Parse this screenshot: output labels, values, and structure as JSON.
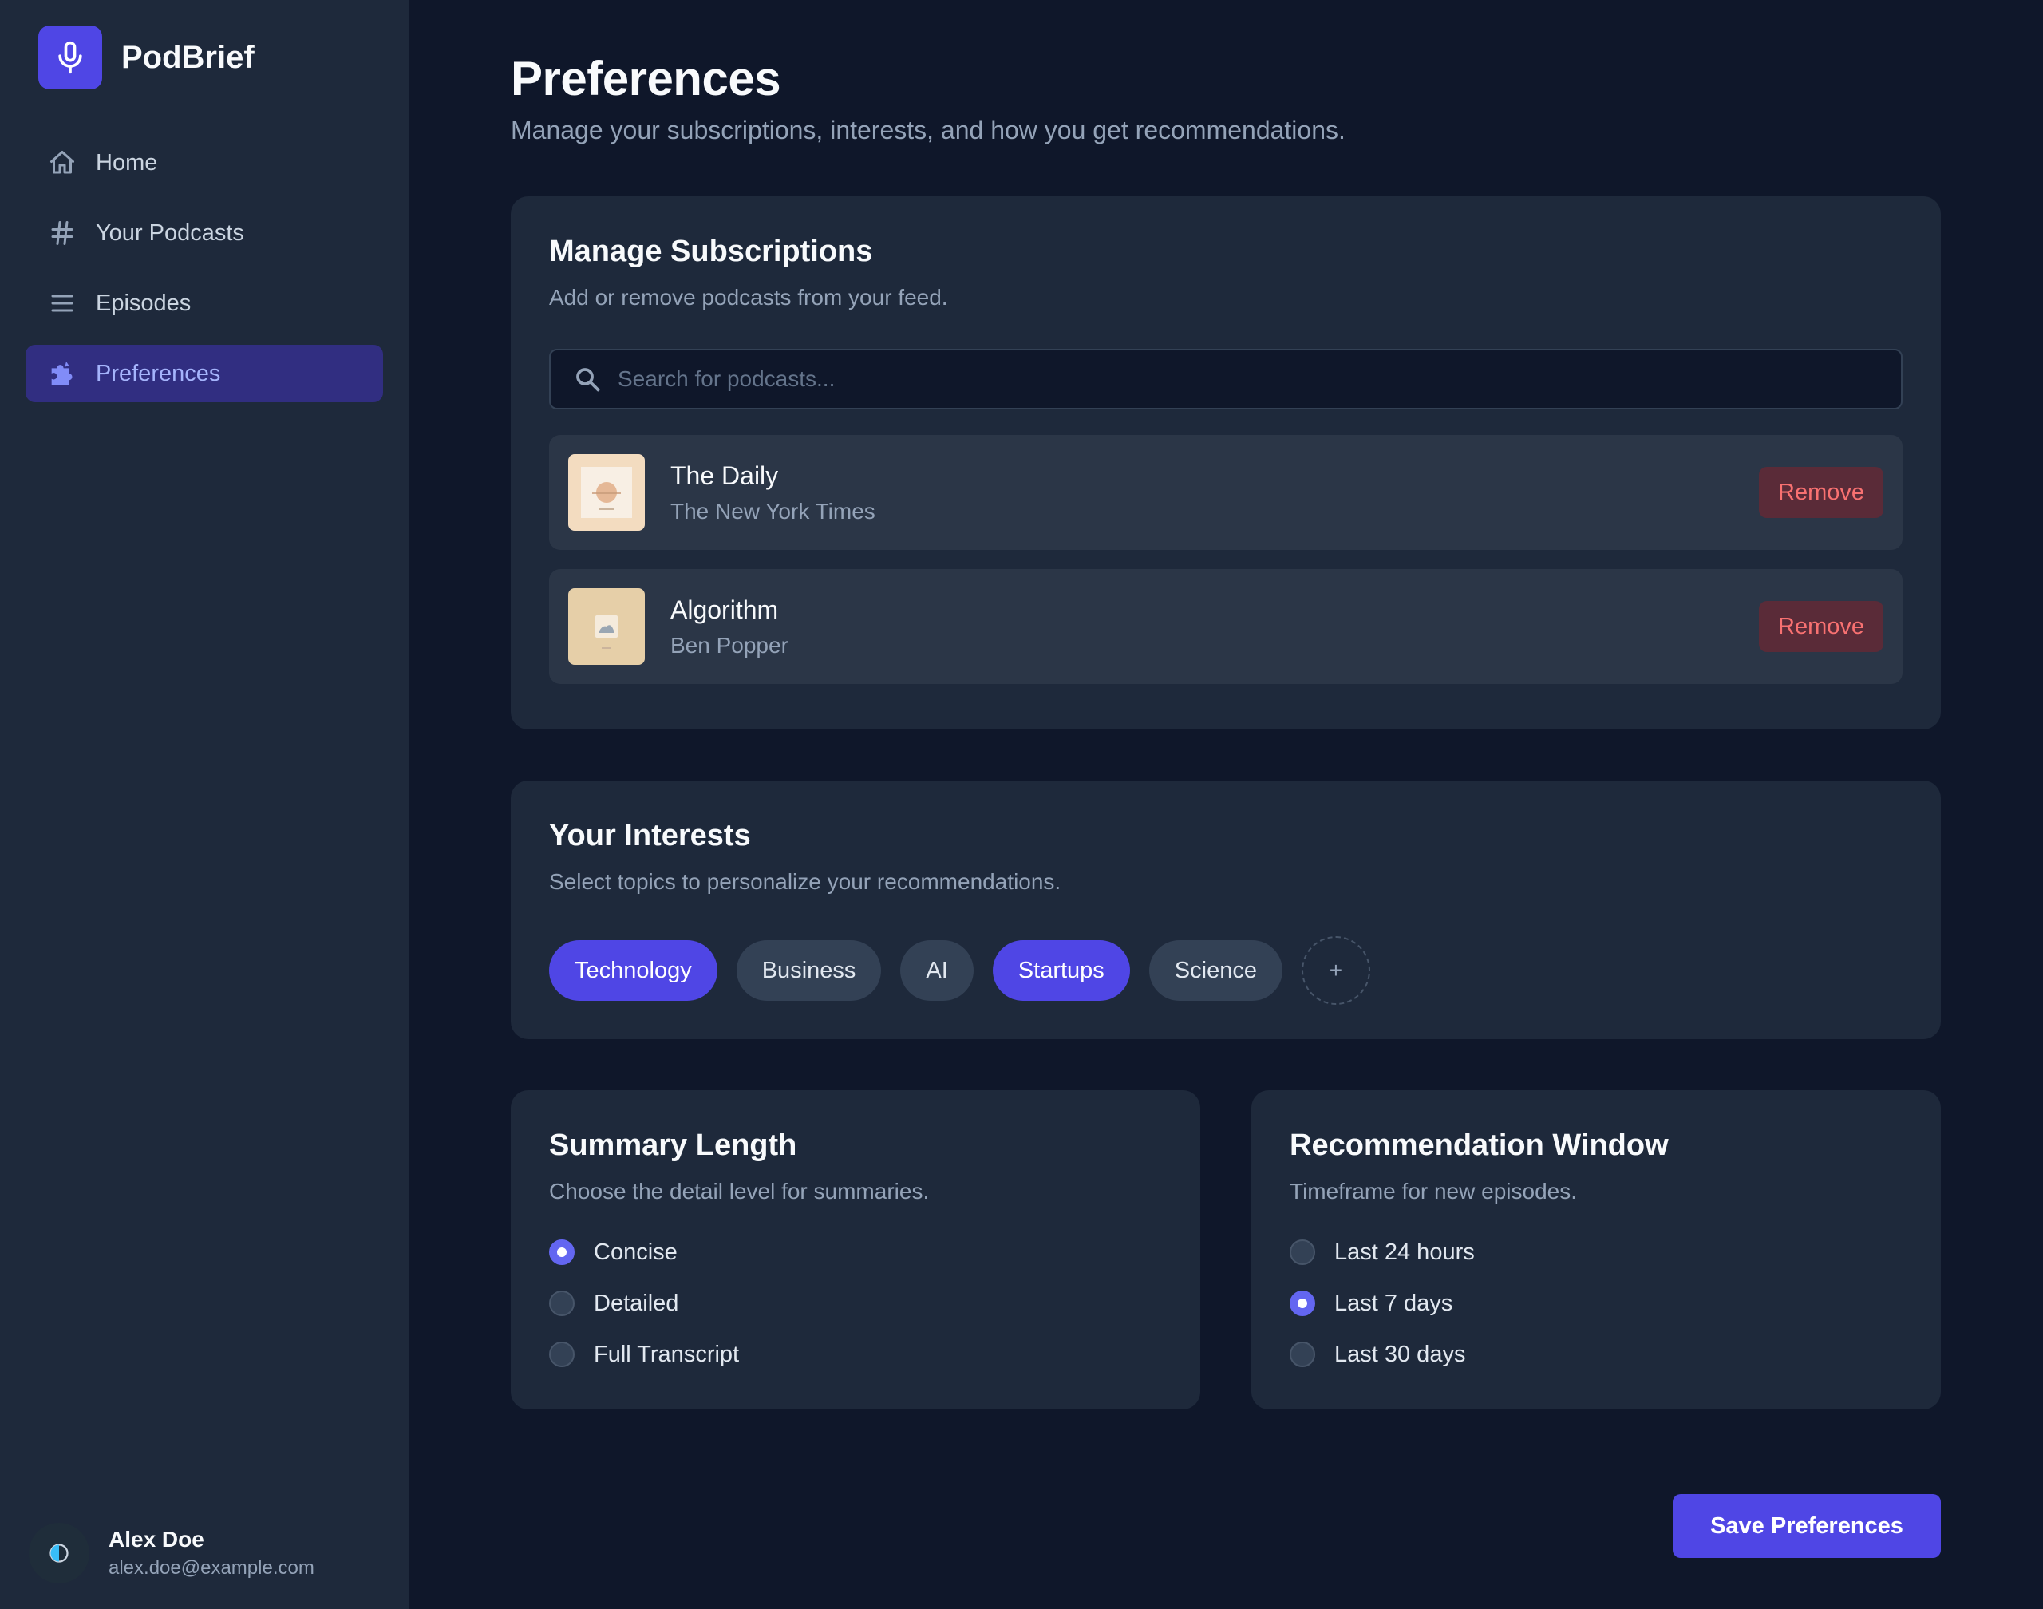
{
  "app": {
    "name": "PodBrief"
  },
  "sidebar": {
    "items": [
      {
        "label": "Home",
        "icon": "home-icon",
        "active": false
      },
      {
        "label": "Your Podcasts",
        "icon": "hash-icon",
        "active": false
      },
      {
        "label": "Episodes",
        "icon": "list-icon",
        "active": false
      },
      {
        "label": "Preferences",
        "icon": "puzzle-icon",
        "active": true
      }
    ]
  },
  "user": {
    "name": "Alex Doe",
    "email": "alex.doe@example.com"
  },
  "page": {
    "title": "Preferences",
    "subtitle": "Manage your subscriptions, interests, and how you get recommendations."
  },
  "subscriptions": {
    "title": "Manage Subscriptions",
    "description": "Add or remove podcasts from your feed.",
    "search_placeholder": "Search for podcasts...",
    "items": [
      {
        "title": "The Daily",
        "author": "The New York Times",
        "remove_label": "Remove"
      },
      {
        "title": "Algorithm",
        "author": "Ben Popper",
        "remove_label": "Remove"
      }
    ]
  },
  "interests": {
    "title": "Your Interests",
    "description": "Select topics to personalize your recommendations.",
    "chips": [
      {
        "label": "Technology",
        "selected": true
      },
      {
        "label": "Business",
        "selected": false
      },
      {
        "label": "AI",
        "selected": false
      },
      {
        "label": "Startups",
        "selected": true
      },
      {
        "label": "Science",
        "selected": false
      }
    ],
    "add_label": "+"
  },
  "summary_length": {
    "title": "Summary Length",
    "description": "Choose the detail level for summaries.",
    "options": [
      {
        "label": "Concise",
        "checked": true
      },
      {
        "label": "Detailed",
        "checked": false
      },
      {
        "label": "Full Transcript",
        "checked": false
      }
    ]
  },
  "recommendation_window": {
    "title": "Recommendation Window",
    "description": "Timeframe for new episodes.",
    "options": [
      {
        "label": "Last 24 hours",
        "checked": false
      },
      {
        "label": "Last 7 days",
        "checked": true
      },
      {
        "label": "Last 30 days",
        "checked": false
      }
    ]
  },
  "actions": {
    "save_label": "Save Preferences"
  },
  "colors": {
    "background": "#0f172a",
    "sidebar": "#1e293b",
    "accent": "#4f46e5",
    "danger": "#f87171"
  }
}
